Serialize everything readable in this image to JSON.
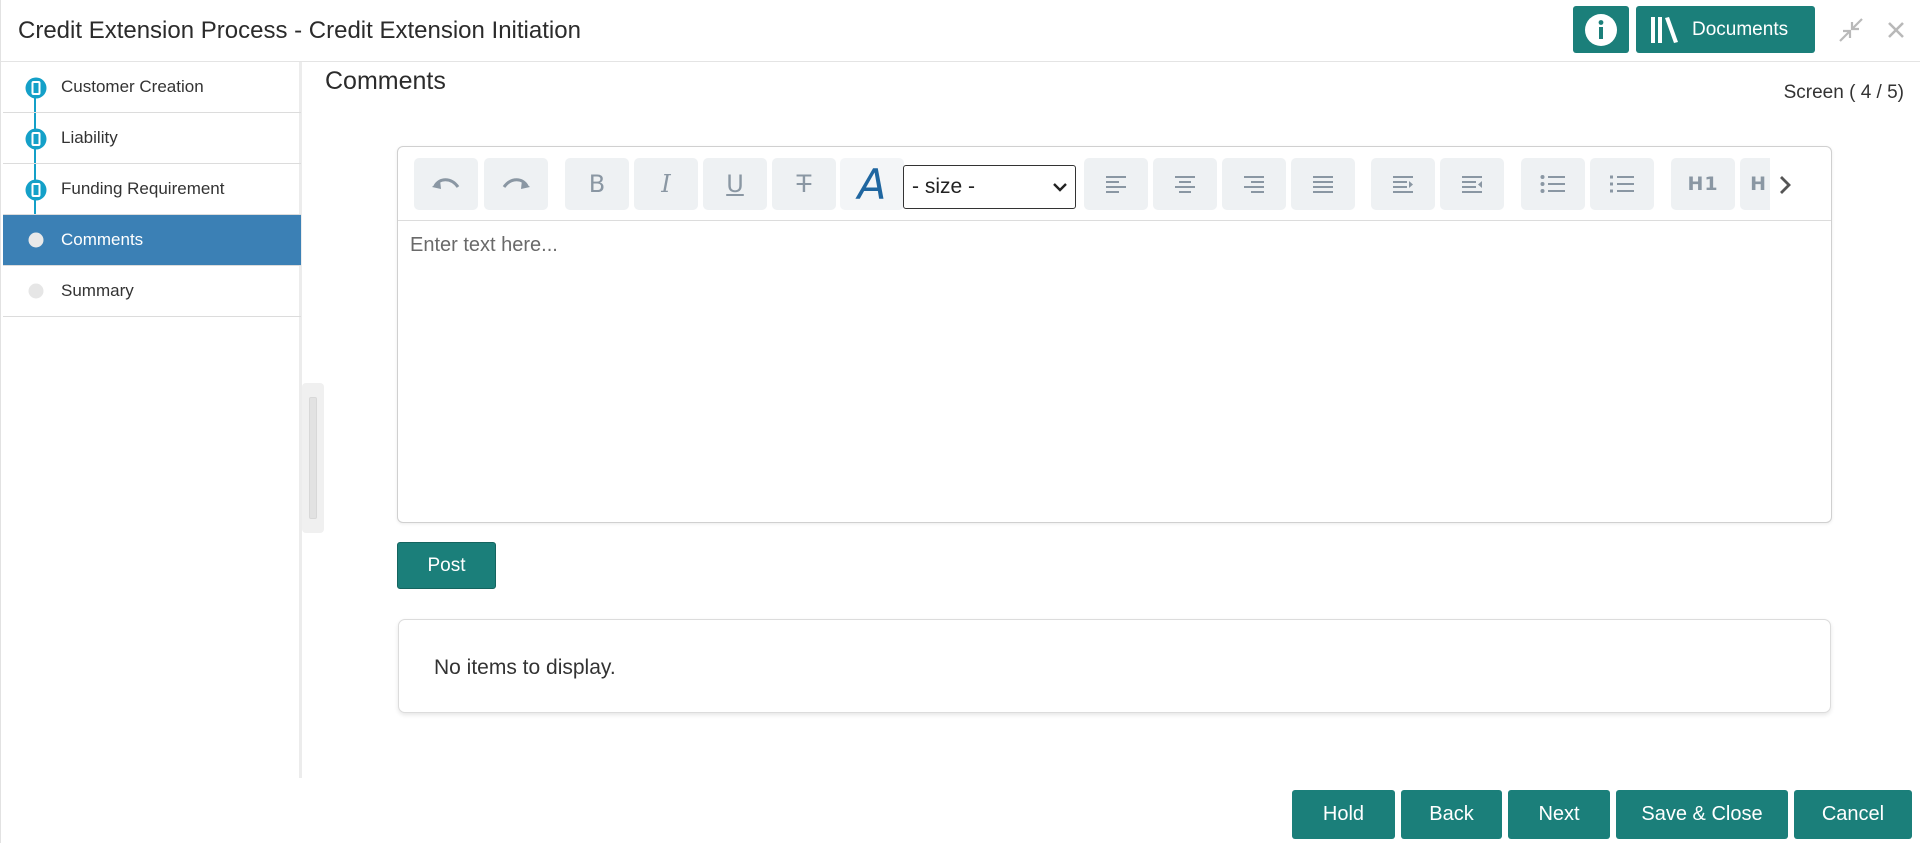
{
  "header": {
    "title": "Credit Extension Process - Credit Extension Initiation",
    "info_icon": "info-icon",
    "documents_label": "Documents",
    "documents_icon": "library-books-icon",
    "minimize_icon": "collapse-arrows-icon",
    "close_icon": "close-icon"
  },
  "sidebar": {
    "steps": [
      {
        "label": "Customer Creation",
        "state": "completed"
      },
      {
        "label": "Liability",
        "state": "completed"
      },
      {
        "label": "Funding Requirement",
        "state": "completed"
      },
      {
        "label": "Comments",
        "state": "active"
      },
      {
        "label": "Summary",
        "state": "pending"
      }
    ]
  },
  "main": {
    "title": "Comments",
    "screen_counter": "Screen ( 4 / 5)",
    "editor": {
      "toolbar": {
        "undo_icon": "undo-icon",
        "redo_icon": "redo-icon",
        "bold": "B",
        "italic": "I",
        "underline": "U",
        "strike": "T",
        "font": "A",
        "size_selected": "- size -",
        "align_left_icon": "align-left-icon",
        "align_center_icon": "align-center-icon",
        "align_right_icon": "align-right-icon",
        "justify_icon": "align-justify-icon",
        "indent_icon": "indent-icon",
        "outdent_icon": "outdent-icon",
        "bullet_list_icon": "bullet-list-icon",
        "numbered_list_icon": "numbered-list-icon",
        "h1": "H1",
        "h2": "H",
        "more_icon": "chevron-right-icon"
      },
      "placeholder": "Enter text here..."
    },
    "post_label": "Post",
    "empty_message": "No items to display."
  },
  "footer": {
    "hold": "Hold",
    "back": "Back",
    "next": "Next",
    "save_close": "Save & Close",
    "cancel": "Cancel"
  },
  "colors": {
    "primary": "#1b7f7a",
    "active_step": "#3b80b5",
    "step_accent": "#14a0c8"
  }
}
